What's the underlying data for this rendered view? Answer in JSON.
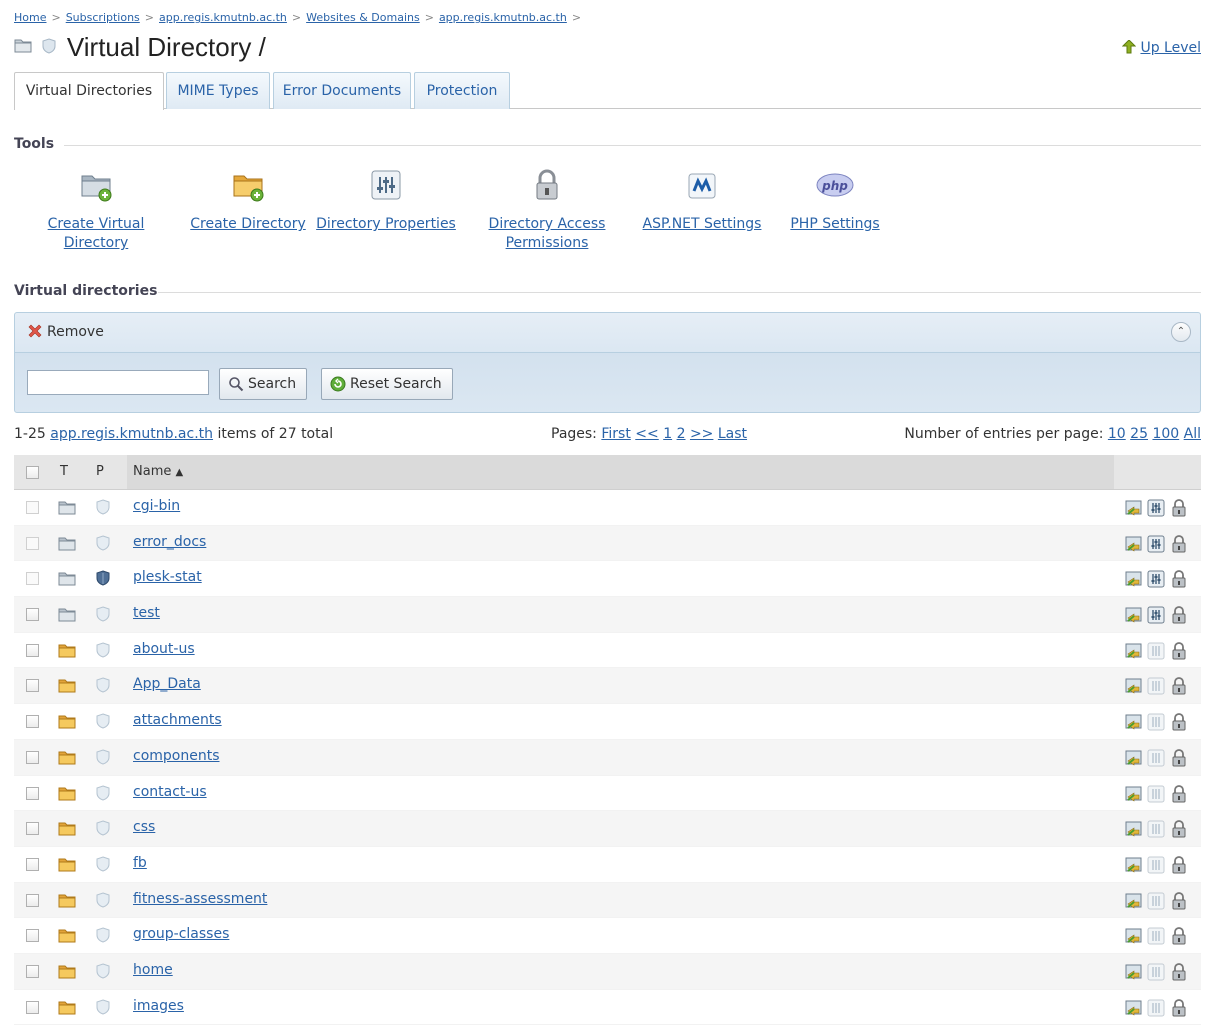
{
  "breadcrumb": [
    "Home",
    "Subscriptions",
    "app.regis.kmutnb.ac.th",
    "Websites & Domains",
    "app.regis.kmutnb.ac.th"
  ],
  "breadcrumb_sep": ">",
  "page_title": "Virtual Directory /",
  "up_level": "Up Level",
  "tabs": [
    {
      "label": "Virtual Directories",
      "active": true
    },
    {
      "label": "MIME Types",
      "active": false
    },
    {
      "label": "Error Documents",
      "active": false
    },
    {
      "label": "Protection",
      "active": false
    }
  ],
  "tools_heading": "Tools",
  "tools": [
    {
      "label": "Create Virtual Directory",
      "icon": "folder-add-icon"
    },
    {
      "label": "Create Directory",
      "icon": "folder-add-icon"
    },
    {
      "label": "Directory Properties",
      "icon": "sliders-icon"
    },
    {
      "label": "Directory Access Permissions",
      "icon": "padlock-icon"
    },
    {
      "label": "ASP.NET Settings",
      "icon": "aspnet-icon"
    },
    {
      "label": "PHP Settings",
      "icon": "php-icon"
    }
  ],
  "vdirs_heading": "Virtual directories",
  "toolbar": {
    "remove_label": "Remove",
    "search_value": "",
    "search_label": "Search",
    "reset_label": "Reset Search"
  },
  "pager": {
    "range": "1-25",
    "domain": "app.regis.kmutnb.ac.th",
    "items_text": "items of 27 total",
    "pages_label": "Pages:",
    "first": "First",
    "prev": "<<",
    "page1": "1",
    "page2": "2",
    "next": ">>",
    "last": "Last",
    "per_page_label": "Number of entries per page:",
    "pp10": "10",
    "pp25": "25",
    "pp100": "100",
    "ppall": "All"
  },
  "columns": {
    "type": "T",
    "protected": "P",
    "name": "Name",
    "sort_indicator": "▲"
  },
  "rows": [
    {
      "name": "cgi-bin",
      "kind": "virtual",
      "protected": false
    },
    {
      "name": "error_docs",
      "kind": "virtual",
      "protected": false
    },
    {
      "name": "plesk-stat",
      "kind": "virtual",
      "protected": true
    },
    {
      "name": "test",
      "kind": "virtual",
      "protected": false
    },
    {
      "name": "about-us",
      "kind": "physical",
      "protected": false
    },
    {
      "name": "App_Data",
      "kind": "physical",
      "protected": false
    },
    {
      "name": "attachments",
      "kind": "physical",
      "protected": false
    },
    {
      "name": "components",
      "kind": "physical",
      "protected": false
    },
    {
      "name": "contact-us",
      "kind": "physical",
      "protected": false
    },
    {
      "name": "css",
      "kind": "physical",
      "protected": false
    },
    {
      "name": "fb",
      "kind": "physical",
      "protected": false
    },
    {
      "name": "fitness-assessment",
      "kind": "physical",
      "protected": false
    },
    {
      "name": "group-classes",
      "kind": "physical",
      "protected": false
    },
    {
      "name": "home",
      "kind": "physical",
      "protected": false
    },
    {
      "name": "images",
      "kind": "physical",
      "protected": false
    }
  ],
  "colors": {
    "link": "#2a63a8",
    "panel": "#dbe7f2",
    "folder_virtual": "#b9c3cc",
    "folder_physical": "#f0c25a"
  }
}
